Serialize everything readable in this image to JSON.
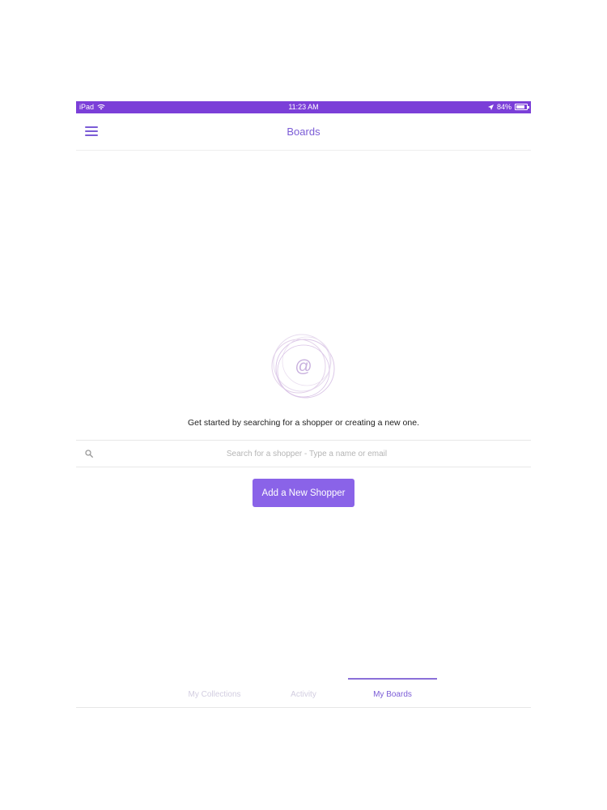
{
  "status_bar": {
    "device": "iPad",
    "time": "11:23 AM",
    "battery": "84%",
    "battery_level": 0.84
  },
  "nav": {
    "title": "Boards"
  },
  "empty_state": {
    "icon": "at-sign-circles-icon",
    "message": "Get started by searching for a shopper or creating a new one."
  },
  "search": {
    "placeholder": "Search for a shopper - Type a name or email",
    "value": ""
  },
  "actions": {
    "add_shopper_label": "Add a New Shopper"
  },
  "tabs": [
    {
      "label": "My Collections",
      "active": false
    },
    {
      "label": "Activity",
      "active": false
    },
    {
      "label": "My Boards",
      "active": true
    }
  ],
  "colors": {
    "status_bar": "#7b3fd8",
    "accent": "#7b5cd6",
    "button": "#8a63e8",
    "inactive_tab": "#d2cde0"
  }
}
